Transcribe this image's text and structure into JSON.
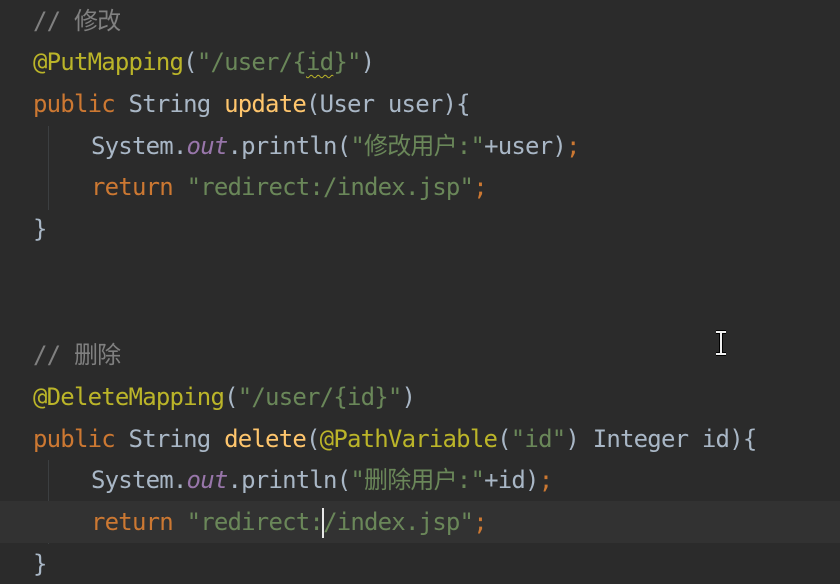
{
  "code": {
    "comment_update": "// 修改",
    "put_annotation": "@PutMapping",
    "put_paren_open": "(",
    "put_path_pre": "\"/user/{",
    "put_path_id": "id",
    "put_path_post": "}\"",
    "put_paren_close": ")",
    "kw_public": "public",
    "type_string": " String ",
    "update_name": "update",
    "update_params": "(User user){",
    "sys_out_pre": "System.",
    "out_field": "out",
    "println_open": ".println(",
    "update_log_str": "\"修改用户:\"",
    "update_log_tail": "+user)",
    "semicolon": ";",
    "kw_return": "return",
    "redirect_full": "\"redirect:/index.jsp\"",
    "redirect_before_caret": "\"redirect:",
    "redirect_after_caret": "/index.jsp\"",
    "close_brace": "}",
    "comment_delete": "// 删除",
    "delete_annotation": "@DeleteMapping",
    "delete_path": "\"/user/{id}\"",
    "delete_name": "delete",
    "path_variable": "@PathVariable",
    "id_literal": "\"id\"",
    "delete_params_tail": " Integer id){",
    "delete_log_str": "\"删除用户:\"",
    "delete_log_tail": "+id)"
  },
  "colors": {
    "background": "#2b2b2b",
    "current_line": "#323232",
    "comment": "#808080",
    "annotation": "#bbb529",
    "keyword": "#cc7832",
    "string": "#6a8759",
    "method": "#ffc66d",
    "static_field": "#9876aa",
    "text": "#a9b7c6"
  },
  "icons": {
    "cursor": "text-ibeam-cursor-icon"
  }
}
